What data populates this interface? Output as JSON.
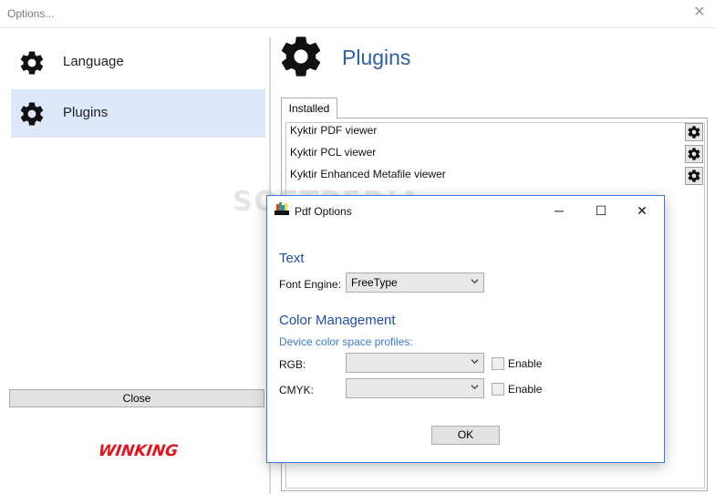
{
  "window": {
    "title": "Options..."
  },
  "nav": {
    "items": [
      {
        "label": "Language",
        "selected": false
      },
      {
        "label": "Plugins",
        "selected": true
      }
    ],
    "close_label": "Close"
  },
  "logo": {
    "text": "WINKING",
    "color": "#e3141b"
  },
  "page": {
    "title": "Plugins",
    "tab_label": "Installed",
    "plugins": [
      "Kyktir PDF viewer",
      "Kyktir PCL viewer",
      "Kyktir Enhanced Metafile viewer"
    ]
  },
  "watermark": "SOFTPEDIA",
  "dialog": {
    "title": "Pdf Options",
    "text_heading": "Text",
    "font_engine_label": "Font Engine:",
    "font_engine_value": "FreeType",
    "color_heading": "Color Management",
    "profiles_label": "Device color space profiles:",
    "rgb_label": "RGB:",
    "cmyk_label": "CMYK:",
    "enable_label": "Enable",
    "ok_label": "OK"
  },
  "colors": {
    "accent": "#2b5fa6",
    "selection": "#dde9fb",
    "dialog_border": "#3a7bd5"
  }
}
